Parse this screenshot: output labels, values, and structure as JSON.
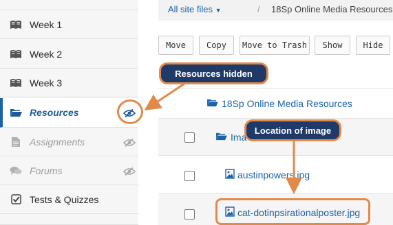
{
  "sidebar": {
    "items": [
      {
        "label": "Week 1",
        "icon": "book-icon",
        "state": "normal"
      },
      {
        "label": "Week 2",
        "icon": "book-icon",
        "state": "normal"
      },
      {
        "label": "Week 3",
        "icon": "book-icon",
        "state": "normal"
      },
      {
        "label": "Resources",
        "icon": "folder-open-icon",
        "state": "active",
        "hidden_icon": "eye-slash-icon"
      },
      {
        "label": "Assignments",
        "icon": "file-icon",
        "state": "dim",
        "hidden_icon": "eye-slash-icon"
      },
      {
        "label": "Forums",
        "icon": "comments-icon",
        "state": "dim",
        "hidden_icon": "eye-slash-icon"
      },
      {
        "label": "Tests & Quizzes",
        "icon": "checkbox-icon",
        "state": "normal"
      }
    ]
  },
  "breadcrumb": {
    "site_files": "All site files",
    "separator": "/",
    "current": "18Sp Online Media Resources"
  },
  "toolbar": {
    "move": "Move",
    "copy": "Copy",
    "move_to_trash": "Move to Trash",
    "show": "Show",
    "hide": "Hide"
  },
  "files": {
    "root_folder": "18Sp Online Media Resources",
    "images_folder": "Ima",
    "file1": "austinpowers.jpg",
    "file2": "cat-dotinpsirationalposter.jpg"
  },
  "callouts": {
    "resources_hidden": "Resources hidden",
    "location_of_image": "Location of image"
  },
  "colors": {
    "accent": "#e28a4a",
    "callout_bg": "#1f3a68",
    "link": "#1c62a8"
  }
}
